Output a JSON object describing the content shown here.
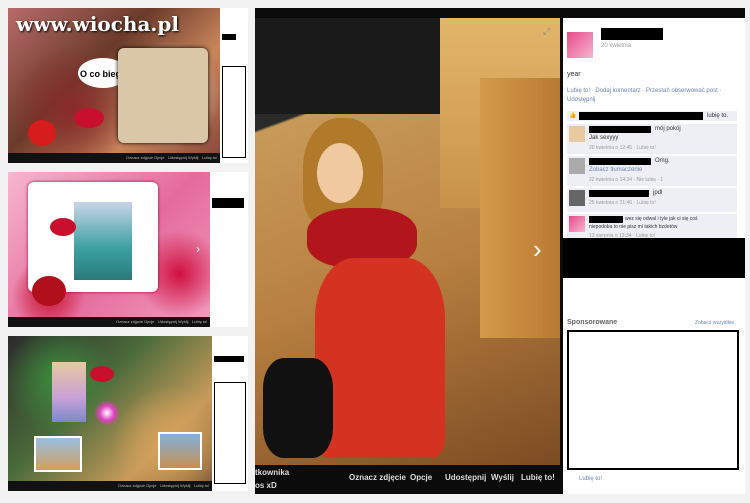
{
  "watermark": "www.wiocha.pl",
  "panel1": {
    "speech": "O co biega",
    "bottom_bar": [
      "Oznacz zdjęcie",
      "Opcje",
      "Udostępnij",
      "Wyślij",
      "Lubię to!"
    ]
  },
  "panel2": {
    "bottom_bar": [
      "Oznacz zdjęcie",
      "Opcje",
      "Udostępnij",
      "Wyślij",
      "Lubię to!"
    ]
  },
  "panel3": {
    "bottom_bar": [
      "Oznacz zdjęcie",
      "Opcje",
      "Udostępnij",
      "Wyślij",
      "Lubię to!"
    ]
  },
  "main": {
    "owner_partial": "tkownika",
    "album_partial": "os xD",
    "actions": {
      "tag": "Oznacz zdjęcie",
      "options": "Opcje",
      "share": "Udostępnij",
      "send": "Wyślij",
      "like": "Lubię to!"
    },
    "sidebar": {
      "post_date": "20 kwietnia",
      "caption": "year",
      "links_line1": "Lubię to! · Dodaj komentarz · Przestań obserwować post ·",
      "links_line2": "Udostępnij",
      "likes_suffix": "lubię to.",
      "comments": [
        {
          "text_suffix": "mój pokój",
          "line2": "Jak sexyyy",
          "meta": "20 kwietnia o 12:45 · Lubię to!"
        },
        {
          "text_suffix": "Omg.",
          "line2": "Zobacz tłumaczenie",
          "meta": "22 kwietnia o 14:34 · Nie lubię · 1"
        },
        {
          "text_suffix": "jpdl",
          "line2": "",
          "meta": "25 kwietnia o 21:46 · Lubię to!"
        },
        {
          "text_suffix": "wez się odwal i tyle jak ci się coś",
          "line2": "niepodoba to nie pisz mi takich bzdetów",
          "meta": "13 sierpnia o 13:34 · Lubię to!"
        }
      ],
      "sponsored": "Sponsorowane",
      "see_all": "Zobacz wszystkie",
      "ad_like": "Lubię to!"
    }
  },
  "colors": {
    "fb_link": "#6d84b4",
    "frame_pink": "#e84a8a",
    "bg": "#0f0f0f"
  }
}
